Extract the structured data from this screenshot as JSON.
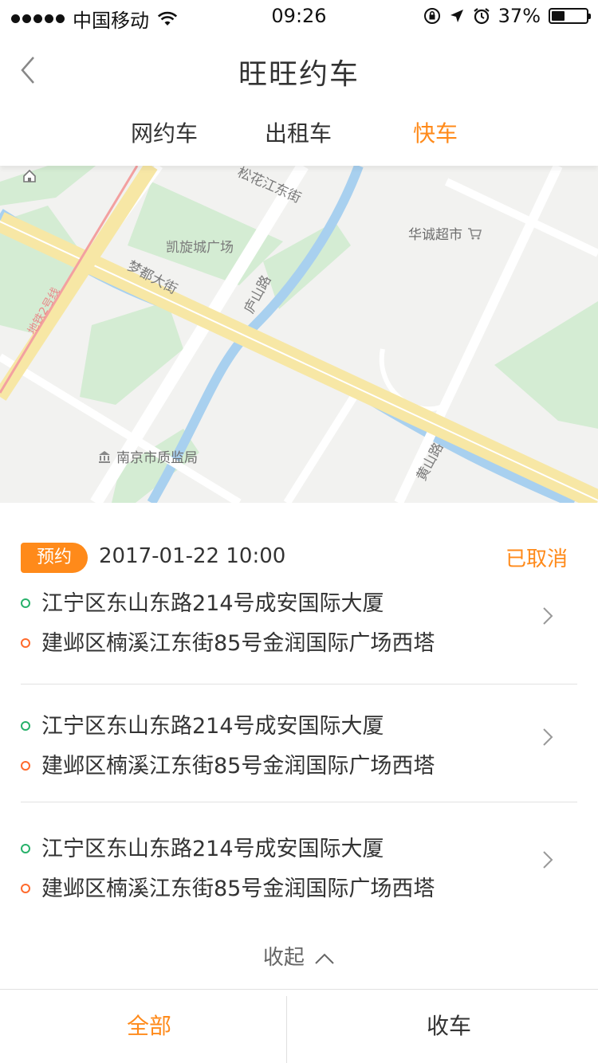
{
  "status_bar": {
    "carrier": "中国移动",
    "time": "09:26",
    "battery_percent": "37%",
    "battery_level": 0.37,
    "icons": [
      "signal-dots-icon",
      "wifi-icon",
      "rotation-lock-icon",
      "location-arrow-icon",
      "alarm-icon",
      "battery-icon"
    ]
  },
  "nav": {
    "title": "旺旺约车",
    "back_icon": "chevron-left-icon"
  },
  "tabs": [
    {
      "label": "网约车",
      "active": false
    },
    {
      "label": "出租车",
      "active": false
    },
    {
      "label": "快车",
      "active": true
    }
  ],
  "map": {
    "labels": {
      "songhuajiang": "松花江东街",
      "kaixuan": "凯旋城广场",
      "huacheng": "华诚超市",
      "mengdu": "梦都大街",
      "lushan": "庐山路",
      "metro": "地铁2号线",
      "zhijian": "南京市质监局",
      "huangshan": "黄山路"
    },
    "icons": [
      "home-icon",
      "cart-icon",
      "government-icon"
    ]
  },
  "order": {
    "badge": "预约",
    "datetime": "2017-01-22 10:00",
    "status": "已取消",
    "routes": [
      {
        "from": "江宁区东山东路214号成安国际大厦",
        "to": "建邺区楠溪江东街85号金润国际广场西塔"
      },
      {
        "from": "江宁区东山东路214号成安国际大厦",
        "to": "建邺区楠溪江东街85号金润国际广场西塔"
      },
      {
        "from": "江宁区东山东路214号成安国际大厦",
        "to": "建邺区楠溪江东街85号金润国际广场西塔"
      }
    ],
    "collapse_label": "收起"
  },
  "bottom": {
    "left_label": "全部",
    "right_label": "收车"
  },
  "colors": {
    "accent": "#ff8a1a",
    "start_dot": "#27b16a",
    "end_dot": "#ff6a2c"
  }
}
